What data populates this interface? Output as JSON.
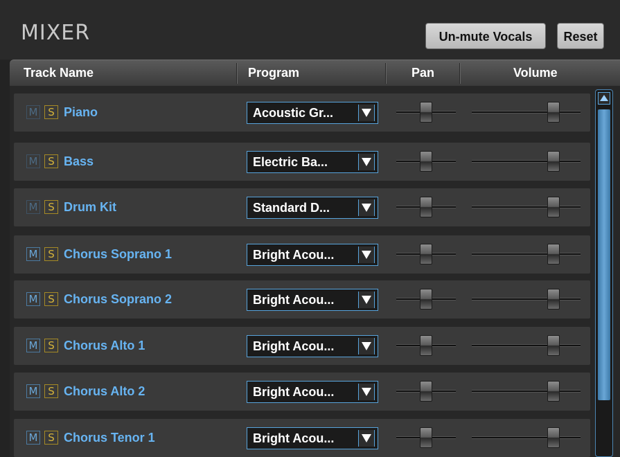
{
  "mixer": {
    "title": "MIXER",
    "buttons": {
      "unmute_label": "Un-mute Vocals",
      "reset_label": "Reset"
    },
    "columns": {
      "track": "Track Name",
      "program": "Program",
      "pan": "Pan",
      "volume": "Volume"
    },
    "tracks": [
      {
        "mute_label": "M",
        "solo_label": "S",
        "name": "Piano",
        "program": "Acoustic Gr...",
        "pan": 0.5,
        "volume": 0.75,
        "mute_dim": true
      },
      {
        "mute_label": "M",
        "solo_label": "S",
        "name": "Bass",
        "program": "Electric Ba...",
        "pan": 0.5,
        "volume": 0.75,
        "mute_dim": true
      },
      {
        "mute_label": "M",
        "solo_label": "S",
        "name": "Drum Kit",
        "program": "Standard D...",
        "pan": 0.5,
        "volume": 0.75,
        "mute_dim": true
      },
      {
        "mute_label": "M",
        "solo_label": "S",
        "name": "Chorus Soprano 1",
        "program": "Bright Acou...",
        "pan": 0.5,
        "volume": 0.75,
        "mute_dim": false
      },
      {
        "mute_label": "M",
        "solo_label": "S",
        "name": "Chorus Soprano 2",
        "program": "Bright Acou...",
        "pan": 0.5,
        "volume": 0.75,
        "mute_dim": false
      },
      {
        "mute_label": "M",
        "solo_label": "S",
        "name": "Chorus Alto 1",
        "program": "Bright Acou...",
        "pan": 0.5,
        "volume": 0.75,
        "mute_dim": false
      },
      {
        "mute_label": "M",
        "solo_label": "S",
        "name": "Chorus Alto 2",
        "program": "Bright Acou...",
        "pan": 0.5,
        "volume": 0.75,
        "mute_dim": false
      },
      {
        "mute_label": "M",
        "solo_label": "S",
        "name": "Chorus Tenor 1",
        "program": "Bright Acou...",
        "pan": 0.5,
        "volume": 0.75,
        "mute_dim": false
      }
    ],
    "scrollbar": {
      "position": 0
    },
    "colors": {
      "accent": "#67b4f2",
      "solo": "#d6b43a",
      "background": "#232323"
    }
  }
}
